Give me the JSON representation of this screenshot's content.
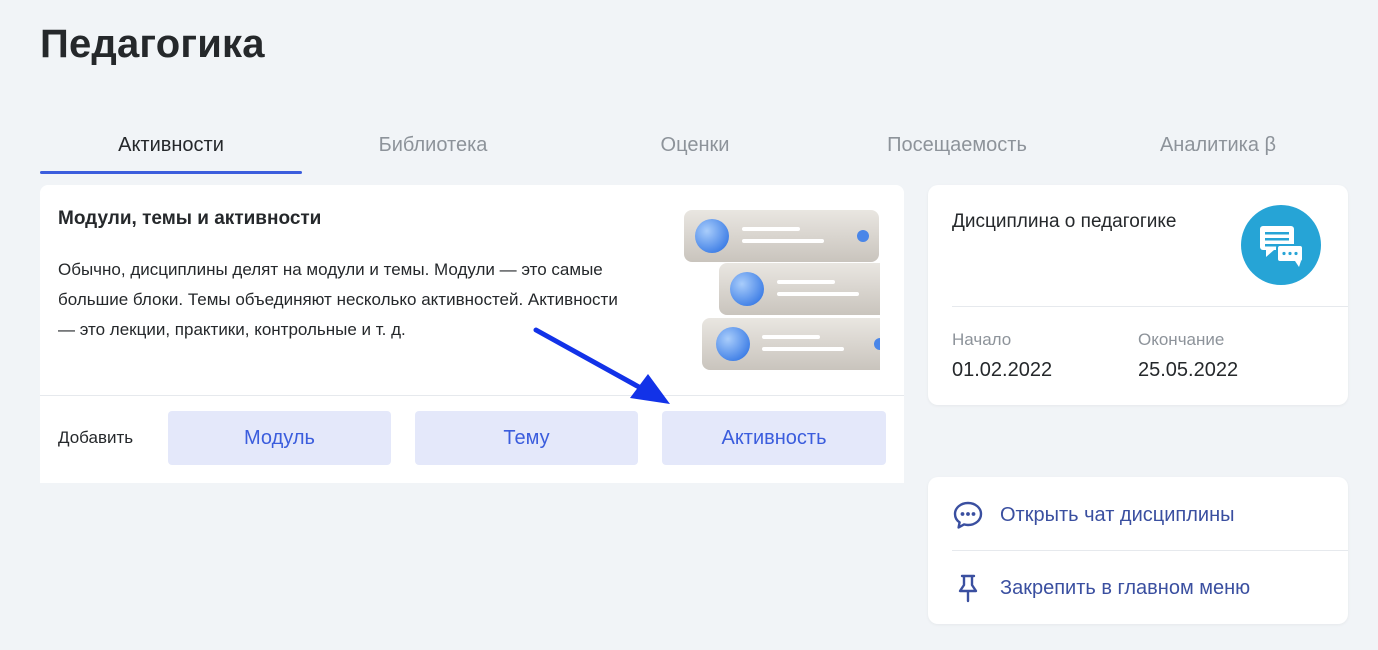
{
  "page": {
    "title": "Педагогика"
  },
  "tabs": [
    {
      "label": "Активности",
      "active": true
    },
    {
      "label": "Библиотека",
      "active": false
    },
    {
      "label": "Оценки",
      "active": false
    },
    {
      "label": "Посещаемость",
      "active": false
    },
    {
      "label": "Аналитика β",
      "active": false
    }
  ],
  "main_card": {
    "title": "Модули, темы и активности",
    "description": "Обычно, дисциплины делят на модули и темы. Модули — это самые большие блоки. Темы объединяют несколько активностей. Активности — это лекции, практики, контрольные и т. д.",
    "add_label": "Добавить",
    "buttons": {
      "module": "Модуль",
      "topic": "Тему",
      "activity": "Активность"
    }
  },
  "course_card": {
    "name": "Дисциплина о педагогике",
    "start_label": "Начало",
    "start_date": "01.02.2022",
    "end_label": "Окончание",
    "end_date": "25.05.2022"
  },
  "actions": {
    "open_chat": "Открыть чат дисциплины",
    "pin_menu": "Закрепить в главном меню"
  },
  "colors": {
    "accent": "#3b5ddd",
    "action_text": "#3a4fa0",
    "button_bg": "#e4e8fa",
    "chat_badge": "#26a4d6",
    "annotation_arrow": "#1232e8",
    "background": "#f1f4f7"
  }
}
